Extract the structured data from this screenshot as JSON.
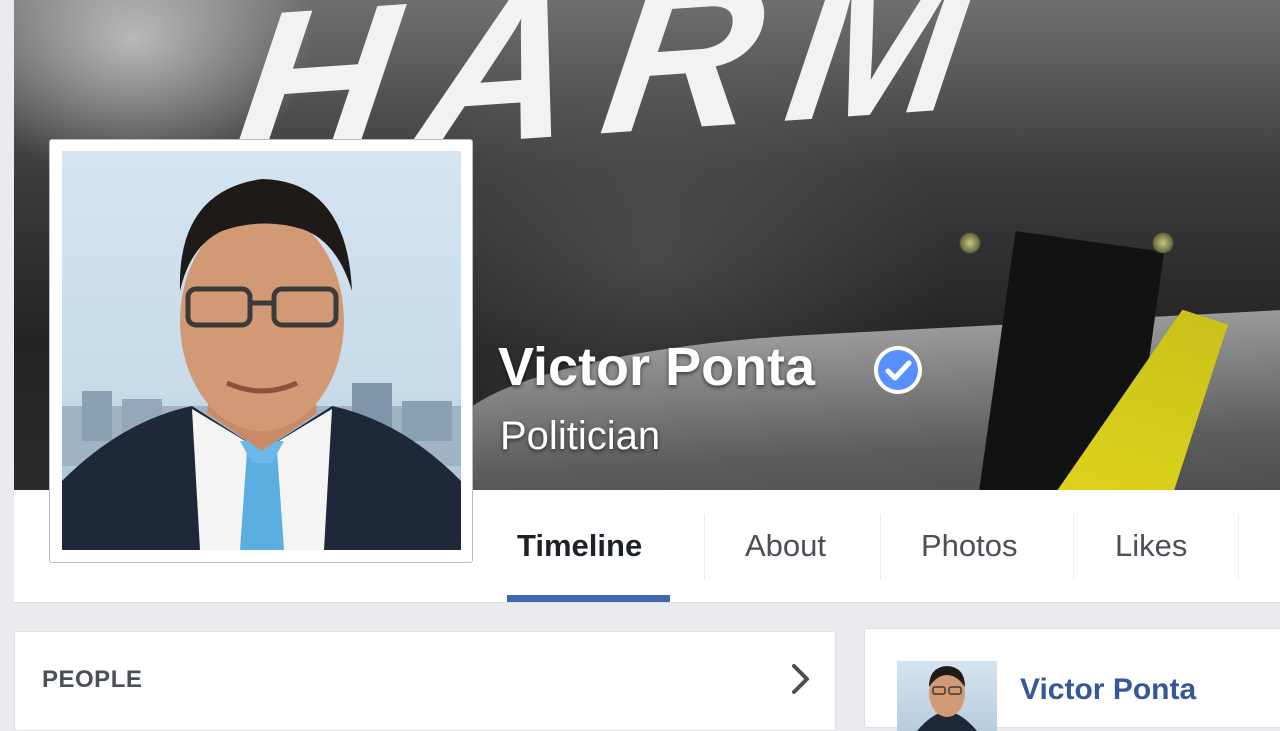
{
  "profile": {
    "name": "Victor Ponta",
    "category": "Politician",
    "verified": true
  },
  "cover": {
    "word": "HARM"
  },
  "tabs": [
    {
      "label": "Timeline",
      "active": true
    },
    {
      "label": "About",
      "active": false
    },
    {
      "label": "Photos",
      "active": false
    },
    {
      "label": "Likes",
      "active": false
    }
  ],
  "people_card": {
    "title": "PEOPLE"
  },
  "side_card": {
    "name": "Victor Ponta"
  },
  "colors": {
    "accent": "#4267b2",
    "link": "#365899",
    "verified_badge": "#5890ff",
    "background": "#e9ebee"
  }
}
